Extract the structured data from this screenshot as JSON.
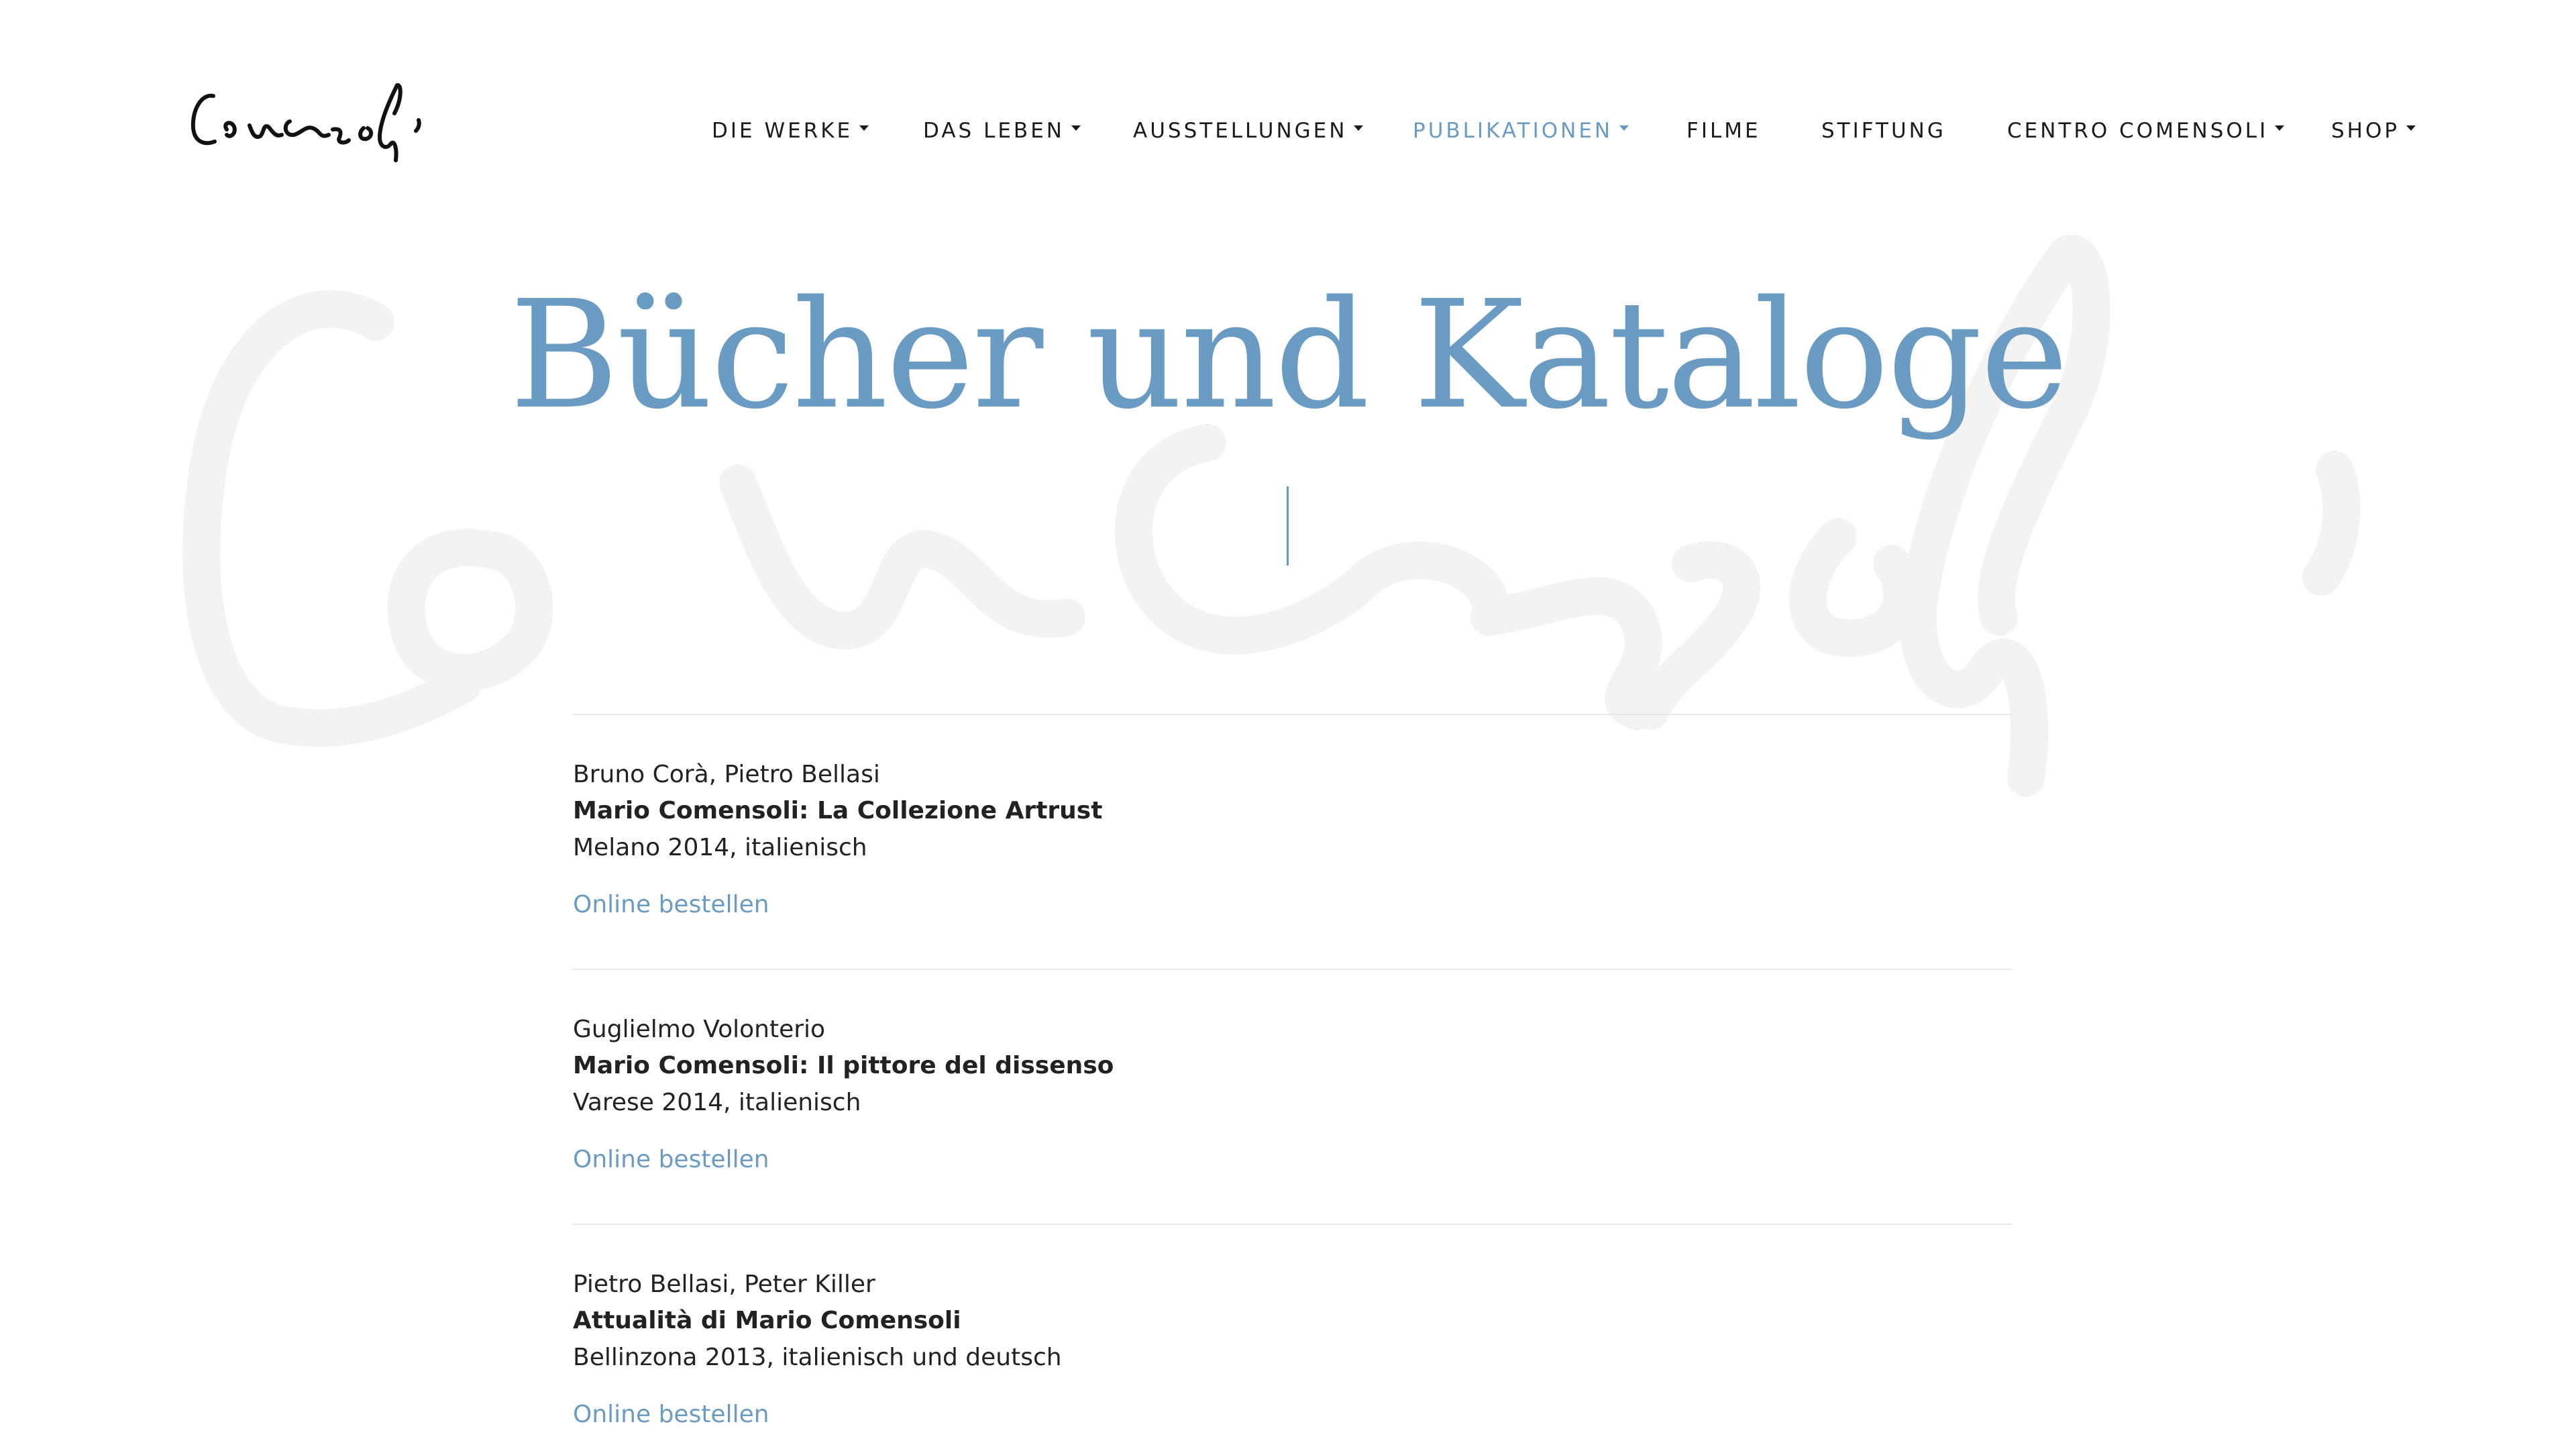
{
  "header": {
    "logo_text": "Comensoli",
    "nav": [
      {
        "label": "DIE WERKE",
        "dropdown": true,
        "active": false
      },
      {
        "label": "DAS LEBEN",
        "dropdown": true,
        "active": false
      },
      {
        "label": "AUSSTELLUNGEN",
        "dropdown": true,
        "active": false
      },
      {
        "label": "PUBLIKATIONEN",
        "dropdown": true,
        "active": true
      },
      {
        "label": "FILME",
        "dropdown": false,
        "active": false
      },
      {
        "label": "STIFTUNG",
        "dropdown": false,
        "active": false
      },
      {
        "label": "CENTRO COMENSOLI",
        "dropdown": true,
        "active": false
      },
      {
        "label": "SHOP",
        "dropdown": true,
        "active": false
      }
    ]
  },
  "main": {
    "title": "Bücher und Kataloge",
    "publications": [
      {
        "authors": "Bruno Corà, Pietro Bellasi",
        "title": "Mario Comensoli: La Collezione Artrust",
        "meta": "Melano 2014, italienisch",
        "link": "Online bestellen"
      },
      {
        "authors": "Guglielmo Volonterio",
        "title": "Mario Comensoli: Il pittore del dissenso",
        "meta": "Varese 2014, italienisch",
        "link": "Online bestellen"
      },
      {
        "authors": "Pietro Bellasi, Peter Killer",
        "title": "Attualità di Mario Comensoli",
        "meta": "Bellinzona 2013, italienisch und deutsch",
        "link": "Online bestellen"
      }
    ]
  },
  "colors": {
    "accent": "#6a9cc3",
    "text": "#222222",
    "divider": "#e8e8e8",
    "watermark": "#f3f3f3"
  },
  "icons": {
    "dropdown": "caret-down-icon"
  }
}
